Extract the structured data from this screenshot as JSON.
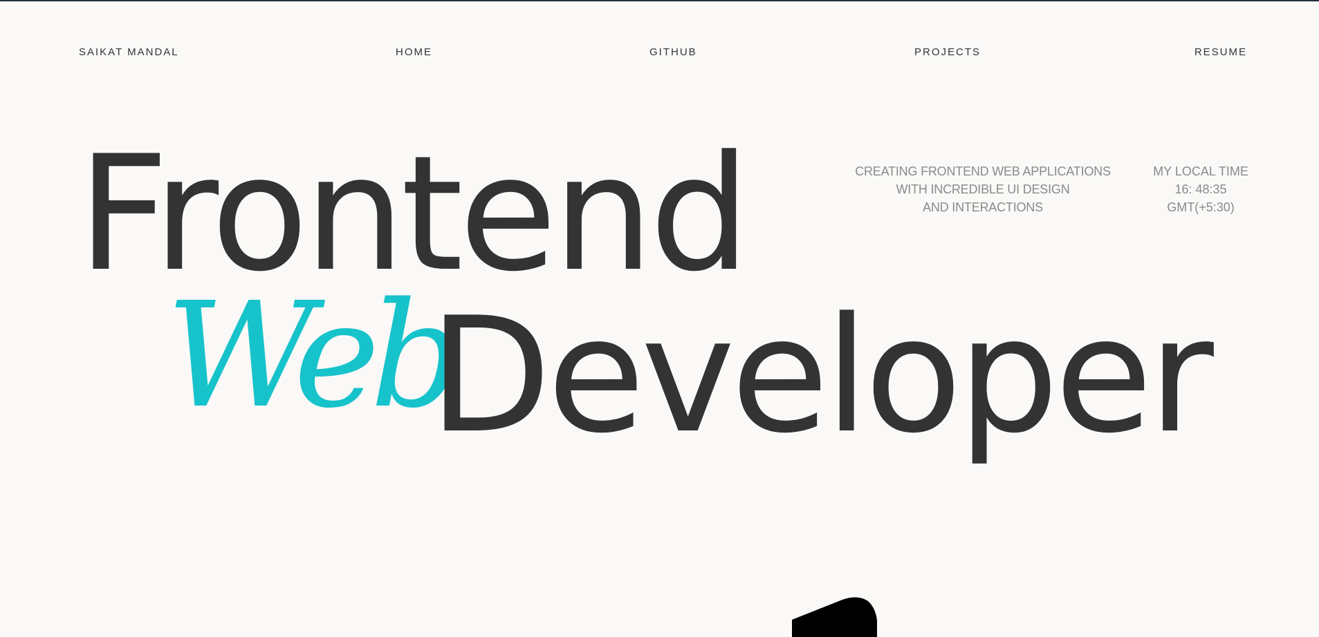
{
  "nav": {
    "brand": "SAIKAT MANDAL",
    "home": "HOME",
    "github": "GITHUB",
    "projects": "PROJECTS",
    "resume": "RESUME"
  },
  "tagline": {
    "line1": "CREATING FRONTEND WEB APPLICATIONS",
    "line2": "WITH INCREDIBLE UI DESIGN",
    "line3": "AND INTERACTIONS"
  },
  "local_time": {
    "label": "MY LOCAL TIME",
    "time": "16: 48:35",
    "zone": "GMT(+5:30)"
  },
  "headline": {
    "line1": "Frontend",
    "accent": "Web",
    "line2": "Developer"
  },
  "colors": {
    "background": "#faf9f7",
    "text": "#333333",
    "accent": "#17c3cb",
    "muted": "#8a8a8a"
  }
}
